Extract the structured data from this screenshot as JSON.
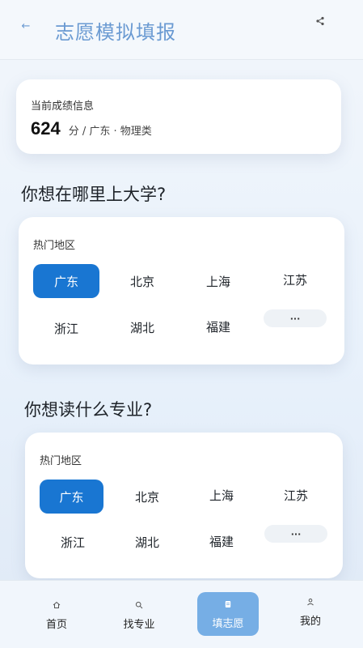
{
  "header": {
    "title": "志愿模拟填报",
    "back_icon": "arrow-left-icon",
    "share_icon": "share-icon"
  },
  "score_card": {
    "label": "当前成绩信息",
    "score": "624",
    "meta": "分 / 广东 · 物理类"
  },
  "question_where": "你想在哪里上大学?",
  "question_major": "你想读什么专业?",
  "region_section_1": {
    "label": "热门地区",
    "items": [
      "广东",
      "北京",
      "上海",
      "江苏",
      "浙江",
      "湖北",
      "福建",
      "···"
    ],
    "selected": "广东"
  },
  "region_section_2": {
    "label": "热门地区",
    "items": [
      "广东",
      "北京",
      "上海",
      "江苏",
      "浙江",
      "湖北",
      "福建",
      "···"
    ],
    "selected": "广东"
  },
  "bottom_nav": [
    {
      "label": "首页",
      "icon": "home-icon"
    },
    {
      "label": "找专业",
      "icon": "search-icon"
    },
    {
      "label": "填志愿",
      "icon": "form-icon",
      "active": true
    },
    {
      "label": "我的",
      "icon": "user-icon"
    }
  ],
  "colors": {
    "accent": "#1976d2",
    "title": "#6a9ad2",
    "nav_active": "#76aee5"
  }
}
